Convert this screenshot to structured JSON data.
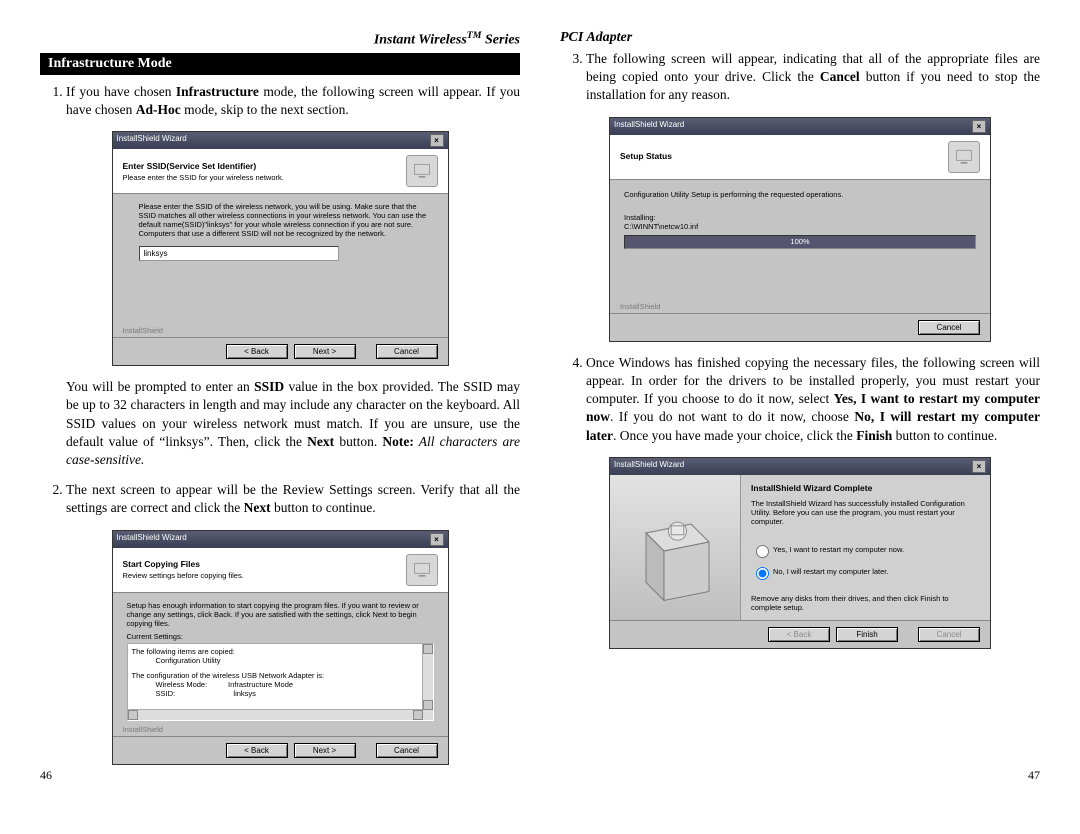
{
  "left": {
    "header": "Instant Wireless",
    "header_sup": "TM",
    "header_suffix": " Series",
    "section": "Infrastructure Mode",
    "li1_a": "If you have chosen ",
    "li1_b": "Infrastructure",
    "li1_c": " mode, the following screen will appear. If you have chosen ",
    "li1_d": "Ad-Hoc",
    "li1_e": " mode, skip to the next section.",
    "wiz1": {
      "title": "InstallShield Wizard",
      "head_title": "Enter SSID(Service Set Identifier)",
      "head_sub": "Please enter the SSID for your wireless network.",
      "body_text": "Please enter the SSID of the wireless network, you will be using. Make sure that the SSID matches all other wireless connections in your wireless network. You can use the default name(SSID)\"linksys\" for your whole wireless connection if you are not sure. Computers that use a different SSID will not be recognized by the network.",
      "ssid_value": "linksys",
      "btn_back": "< Back",
      "btn_next": "Next >",
      "btn_cancel": "Cancel",
      "ishield": "InstallShield"
    },
    "p2_a": "You will be prompted to enter an ",
    "p2_b": "SSID",
    "p2_c": " value in the box provided. The SSID may be up to 32 characters in length and may include any character on the keyboard. All SSID values on your wireless network must match. If you are unsure, use the default value of “linksys”. Then, click the ",
    "p2_d": "Next",
    "p2_e": " button. ",
    "p2_note_label": "Note:",
    "p2_note_text": " All characters are case-sensitive.",
    "li2_a": "The next screen to appear will be the Review Settings screen. Verify that all the settings are correct and click the ",
    "li2_b": "Next",
    "li2_c": " button to continue.",
    "wiz2": {
      "title": "InstallShield Wizard",
      "head_title": "Start Copying Files",
      "head_sub": "Review settings before copying files.",
      "body_intro": "Setup has enough information to start copying the program files. If you want to review or change any settings, click Back. If you are satisfied with the settings, click Next to begin copying files.",
      "cur_settings_label": "Current Settings:",
      "line1": "The following items are copied:",
      "line1b": "Configuration Utility",
      "line2": "The configuration of the wireless USB Network Adapter is:",
      "line2b": "Wireless Mode:          Infrastructure Mode",
      "line2c": "SSID:                            linksys",
      "btn_back": "< Back",
      "btn_next": "Next >",
      "btn_cancel": "Cancel",
      "ishield": "InstallShield"
    },
    "pagenum": "46"
  },
  "right": {
    "header": "PCI Adapter",
    "li3_a": "The following screen will appear, indicating that all of the appropriate files are being copied onto your drive. Click the ",
    "li3_b": "Cancel",
    "li3_c": " button if you need to stop the installation for any reason.",
    "wiz3": {
      "title": "InstallShield Wizard",
      "head_title": "Setup Status",
      "body_line": "Configuration Utility Setup is performing the requested operations.",
      "installing_label": "Installing:",
      "install_path": "C:\\WINNT\\netcw10.inf",
      "progress_text": "100%",
      "btn_cancel": "Cancel",
      "ishield": "InstallShield"
    },
    "li4_a": "Once Windows has finished copying the necessary files, the following screen will appear. In order for the drivers to be installed properly, you must restart your computer. If you choose to do it now, select ",
    "li4_b": "Yes, I want to restart my computer now",
    "li4_c": ". If you do not want to do it now, choose ",
    "li4_d": "No, I will restart my computer later",
    "li4_e": ". Once you have made your choice, click the ",
    "li4_f": "Finish",
    "li4_g": " button to continue.",
    "wiz4": {
      "title": "InstallShield Wizard",
      "head_title": "InstallShield Wizard Complete",
      "body_text": "The InstallShield Wizard has successfully installed Configuration Utility. Before you can use the program, you must restart your computer.",
      "radio_yes": "Yes, I want to restart my computer now.",
      "radio_no": "No, I will restart my computer later.",
      "remove_text": "Remove any disks from their drives, and then click Finish to complete setup.",
      "btn_back": "< Back",
      "btn_finish": "Finish",
      "btn_cancel": "Cancel"
    },
    "pagenum": "47"
  }
}
